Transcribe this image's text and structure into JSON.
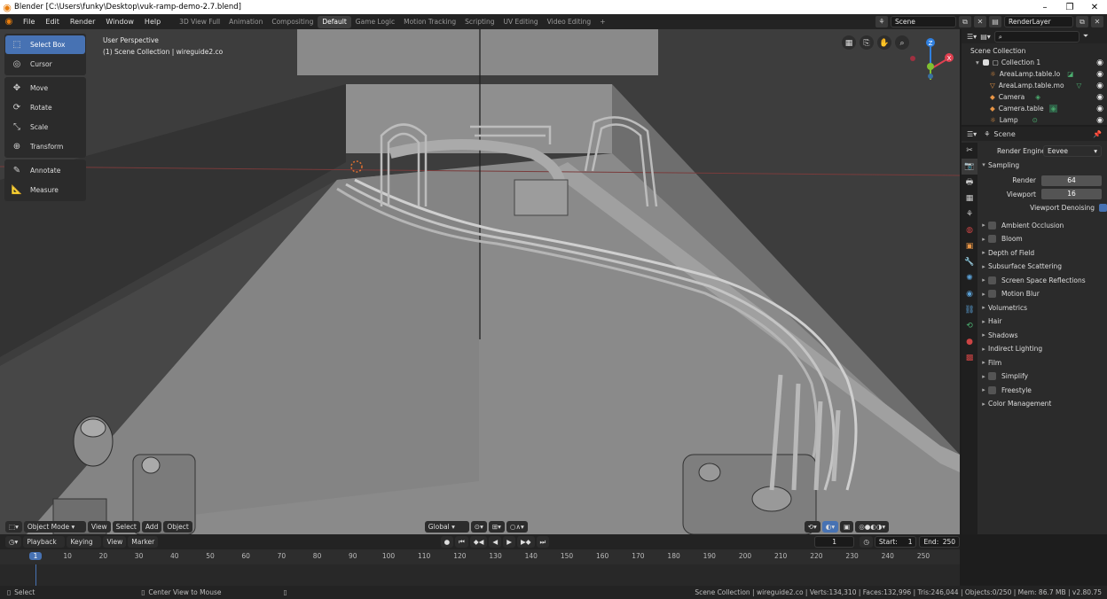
{
  "window": {
    "title": "Blender [C:\\Users\\funky\\Desktop\\vuk-ramp-demo-2.7.blend]"
  },
  "menus": [
    "File",
    "Edit",
    "Render",
    "Window",
    "Help"
  ],
  "workspaces": [
    "3D View Full",
    "Animation",
    "Compositing",
    "Default",
    "Game Logic",
    "Motion Tracking",
    "Scripting",
    "UV Editing",
    "Video Editing"
  ],
  "active_workspace": "Default",
  "add_tab": "+",
  "scene_selector": {
    "value": "Scene"
  },
  "layer_selector": {
    "value": "RenderLayer"
  },
  "toolbar": {
    "tools": [
      {
        "label": "Select Box",
        "icon": "select-box-icon",
        "active": true
      },
      {
        "label": "Cursor",
        "icon": "cursor-icon"
      },
      {
        "label": "Move",
        "icon": "move-icon"
      },
      {
        "label": "Rotate",
        "icon": "rotate-icon"
      },
      {
        "label": "Scale",
        "icon": "scale-icon"
      },
      {
        "label": "Transform",
        "icon": "transform-icon"
      },
      {
        "label": "Annotate",
        "icon": "annotate-icon"
      },
      {
        "label": "Measure",
        "icon": "measure-icon"
      }
    ]
  },
  "viewport": {
    "perspective": "User Perspective",
    "collection_info": "(1) Scene Collection | wireguide2.co",
    "axes": {
      "x": "X",
      "y": "Y",
      "z": "Z"
    },
    "header": {
      "mode": "Object Mode",
      "menus": [
        "View",
        "Select",
        "Add",
        "Object"
      ],
      "orientation": "Global"
    }
  },
  "outliner": {
    "root": "Scene Collection",
    "collection": "Collection 1",
    "items": [
      {
        "label": "AreaLamp.table.lo",
        "color": "#e89545"
      },
      {
        "label": "AreaLamp.table.mo",
        "color": "#e89545"
      },
      {
        "label": "Camera",
        "color": "#e89545"
      },
      {
        "label": "Camera.table",
        "color": "#e89545"
      },
      {
        "label": "Lamp",
        "color": "#e89545"
      }
    ]
  },
  "properties": {
    "context": "Scene",
    "render_engine_label": "Render Engine",
    "render_engine": "Eevee",
    "sampling": {
      "title": "Sampling",
      "render_label": "Render",
      "render_value": "64",
      "viewport_label": "Viewport",
      "viewport_value": "16",
      "denoise_label": "Viewport Denoising"
    },
    "panels": [
      {
        "label": "Ambient Occlusion",
        "check": true
      },
      {
        "label": "Bloom",
        "check": true
      },
      {
        "label": "Depth of Field",
        "check": false
      },
      {
        "label": "Subsurface Scattering",
        "check": false
      },
      {
        "label": "Screen Space Reflections",
        "check": true
      },
      {
        "label": "Motion Blur",
        "check": true
      },
      {
        "label": "Volumetrics",
        "check": false
      },
      {
        "label": "Hair",
        "check": false
      },
      {
        "label": "Shadows",
        "check": false
      },
      {
        "label": "Indirect Lighting",
        "check": false
      },
      {
        "label": "Film",
        "check": false
      },
      {
        "label": "Simplify",
        "check": true
      },
      {
        "label": "Freestyle",
        "check": true
      },
      {
        "label": "Color Management",
        "check": false
      }
    ]
  },
  "timeline": {
    "menus": [
      "Playback",
      "Keying",
      "View",
      "Marker"
    ],
    "current_frame": "1",
    "start_label": "Start:",
    "start": "1",
    "end_label": "End:",
    "end": "250",
    "ruler": [
      "1",
      "10",
      "20",
      "30",
      "40",
      "50",
      "60",
      "70",
      "80",
      "90",
      "100",
      "110",
      "120",
      "130",
      "140",
      "150",
      "160",
      "170",
      "180",
      "190",
      "200",
      "210",
      "220",
      "230",
      "240",
      "250"
    ]
  },
  "statusbar": {
    "left": "Select",
    "middle": "Center View to Mouse",
    "stats": "Scene Collection | wireguide2.co | Verts:134,310 | Faces:132,996 | Tris:246,044 | Objects:0/250 | Mem: 86.7 MB | v2.80.75"
  },
  "colors": {
    "accent": "#4772b3",
    "axis_x": "#e04050",
    "axis_y": "#80c030",
    "axis_z": "#3080e0",
    "object": "#e89545"
  }
}
